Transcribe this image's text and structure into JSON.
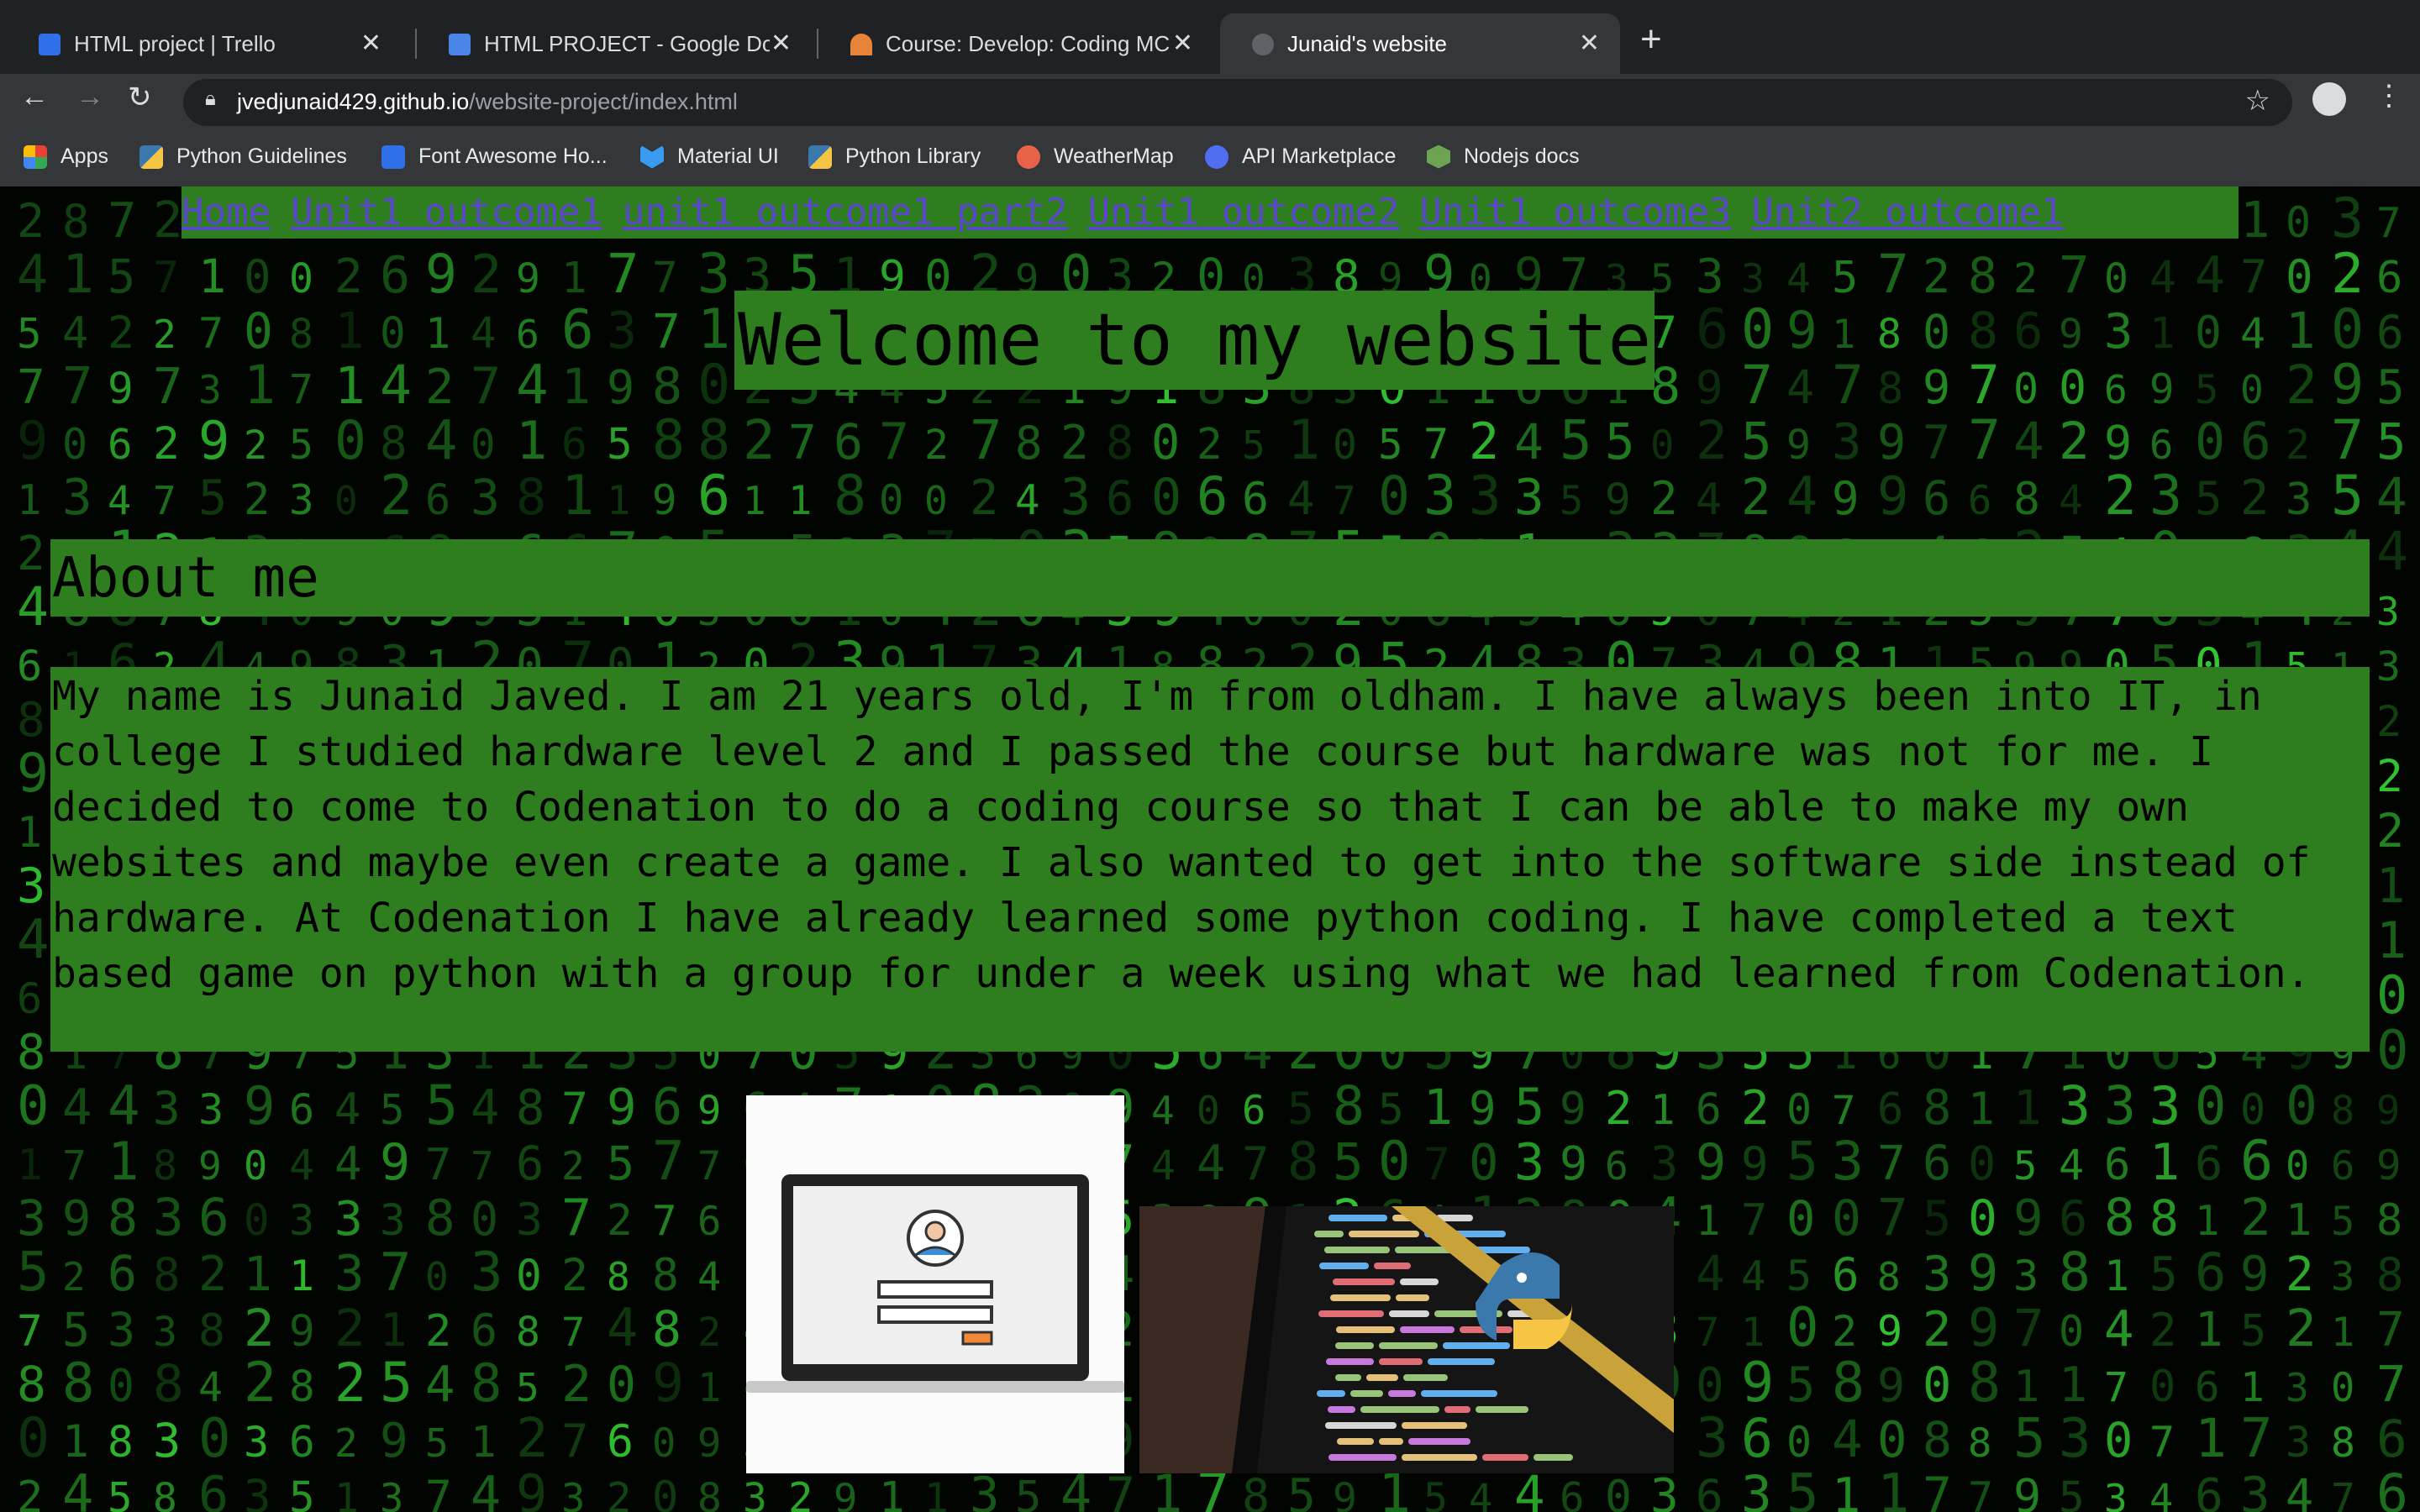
{
  "browser": {
    "tabs": [
      {
        "title": "HTML project | Trello",
        "icon": "trello-icon",
        "color": "#2f6fe8"
      },
      {
        "title": "HTML PROJECT - Google Docs",
        "icon": "google-docs-icon",
        "color": "#4a86e8"
      },
      {
        "title": "Course: Develop: Coding MCR",
        "icon": "codenation-icon",
        "color": "#e8833a"
      },
      {
        "title": "Junaid's website",
        "icon": "globe-icon",
        "color": "#5f6368"
      }
    ],
    "url_host": "jvedjunaid429.github.io",
    "url_path": "/website-project/index.html",
    "bookmarks": [
      {
        "label": "Apps",
        "icon": "apps-grid-icon",
        "color": "#e94235"
      },
      {
        "label": "Python Guidelines",
        "icon": "python-icon",
        "color": "#f6c543"
      },
      {
        "label": "Font Awesome Ho...",
        "icon": "font-awesome-flag-icon",
        "color": "#2f6fe8"
      },
      {
        "label": "Material UI",
        "icon": "material-ui-icon",
        "color": "#3a9cf0"
      },
      {
        "label": "Python Library",
        "icon": "python-icon",
        "color": "#f6c543"
      },
      {
        "label": "WeatherMap",
        "icon": "weathermap-icon",
        "color": "#e8624a"
      },
      {
        "label": "API Marketplace",
        "icon": "api-marketplace-icon",
        "color": "#4f6ff0"
      },
      {
        "label": "Nodejs docs",
        "icon": "nodejs-icon",
        "color": "#6ca453"
      }
    ]
  },
  "site": {
    "nav_links": [
      "Home",
      "Unit1 outcome1",
      "unit1 outcome1 part2",
      "Unit1 outcome2",
      "Unit1 outcome3",
      "Unit2 outcome1"
    ],
    "title": "Welcome to my website",
    "about_heading": "About me",
    "about_text": "My name is Junaid Javed. I am 21 years old, I'm from oldham. I have always been into IT, in college I studied hardware level 2 and I passed the course but hardware was not for me. I decided to come to Codenation to do a coding course so that I can be able to make my own websites and maybe even create a game. I also wanted to get into the software side instead of hardware. At Codenation I have already learned some python coding. I have completed a text based game on python with a group for under a week using what we had learned from Codenation.",
    "accent_color": "#2e7d1f",
    "link_color": "#5a47c9"
  }
}
